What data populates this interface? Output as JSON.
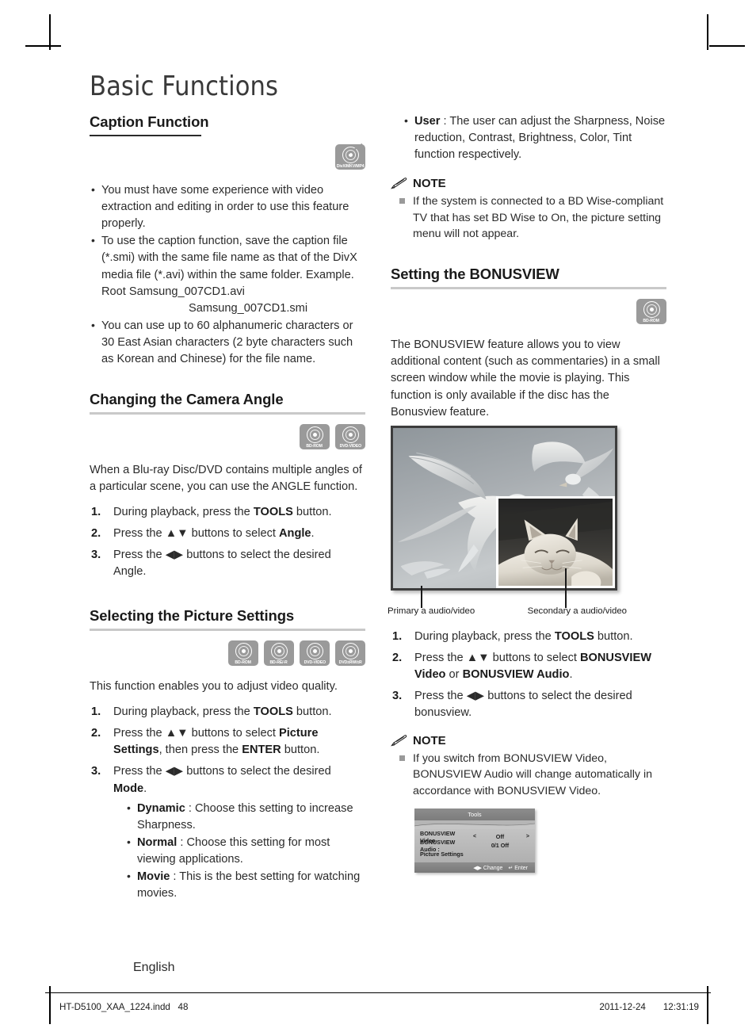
{
  "page": {
    "title": "Basic Functions",
    "language": "English"
  },
  "footer": {
    "file": "HT-D5100_XAA_1224.indd",
    "page_number": "48",
    "date": "2011-12-24",
    "time": "12:31:19"
  },
  "left_column": {
    "caption_section": {
      "heading": "Caption Function",
      "badges": [
        {
          "label": "DivX/MKV/MP4",
          "icon": "disc-icon"
        }
      ],
      "bullets": [
        "You must have some experience with video extraction and editing in order to use this feature properly.",
        "To use the caption function, save the caption file (*.smi) with the same file name as that of the DivX media file (*.avi) within the same folder. Example. Root Samsung_007CD1.avi",
        "You can use up to 60 alphanumeric characters or 30 East Asian characters (2 byte characters such as Korean and Chinese) for the file name."
      ],
      "bullet2_indent_line": "Samsung_007CD1.smi"
    },
    "angle_section": {
      "heading": "Changing the Camera Angle",
      "badges": [
        {
          "label": "BD-ROM",
          "icon": "disc-icon"
        },
        {
          "label": "DVD-VIDEO",
          "icon": "disc-icon"
        }
      ],
      "intro": "When a Blu-ray Disc/DVD contains multiple angles of a particular scene, you can use the ANGLE function.",
      "steps": [
        {
          "num": "1.",
          "pre": "During playback, press the ",
          "bold": "TOOLS",
          "post": " button."
        },
        {
          "num": "2.",
          "pre": "Press the ▲▼ buttons to select ",
          "bold": "Angle",
          "post": "."
        },
        {
          "num": "3.",
          "pre": "Press the ◀▶ buttons to select the desired ",
          "bold": "",
          "post": "Angle."
        }
      ]
    },
    "picture_section": {
      "heading": "Selecting the Picture Settings",
      "badges": [
        {
          "label": "BD-ROM",
          "icon": "disc-icon"
        },
        {
          "label": "BD-RE/-R",
          "icon": "disc-icon"
        },
        {
          "label": "DVD-VIDEO",
          "icon": "disc-icon"
        },
        {
          "label": "DVD±RW/±R",
          "icon": "disc-icon"
        }
      ],
      "intro": "This function enables you to adjust video quality.",
      "steps": [
        {
          "num": "1.",
          "pre": "During playback, press the ",
          "bold": "TOOLS",
          "post": " button."
        },
        {
          "num": "2.",
          "pre": "Press the ▲▼ buttons to select ",
          "bold": "Picture Settings",
          "post": ", then press the ",
          "bold2": "ENTER",
          "post2": " button."
        },
        {
          "num": "3.",
          "pre": "Press the ◀▶ buttons to select the desired ",
          "bold": "Mode",
          "post": "."
        }
      ],
      "modes": [
        {
          "name": "Dynamic",
          "desc": " : Choose this setting to increase Sharpness."
        },
        {
          "name": "Normal",
          "desc": " : Choose this setting for most viewing applications."
        },
        {
          "name": "Movie",
          "desc": " : This is the best setting for watching movies."
        }
      ]
    }
  },
  "right_column": {
    "user_mode": {
      "name": "User",
      "desc": " : The user can adjust the Sharpness, Noise reduction, Contrast, Brightness, Color, Tint function respectively."
    },
    "note1": {
      "label": "NOTE",
      "icon": "pencil-icon",
      "items": [
        "If the system is connected to a BD Wise-compliant TV that has set BD Wise to On, the picture setting menu will not appear."
      ]
    },
    "bonusview_section": {
      "heading": "Setting the BONUSVIEW",
      "badges": [
        {
          "label": "BD-ROM",
          "icon": "disc-icon"
        }
      ],
      "intro": "The BONUSVIEW feature allows you to view additional content (such as commentaries) in a small screen window while the movie is playing. This function is only available if the disc has the Bonusview feature.",
      "figure": {
        "primary_caption": "Primary a audio/video",
        "secondary_caption": "Secondary a audio/video",
        "primary_alt": "seagulls-flying-photo",
        "secondary_alt": "sleeping-cat-photo"
      },
      "steps": [
        {
          "num": "1.",
          "pre": "During playback, press the ",
          "bold": "TOOLS",
          "post": " button."
        },
        {
          "num": "2.",
          "pre": "Press the ▲▼ buttons to select ",
          "bold": "BONUSVIEW Video",
          "mid": " or ",
          "bold2": "BONUSVIEW Audio",
          "post": "."
        },
        {
          "num": "3.",
          "pre": "Press the ◀▶ buttons to select the desired bonusview.",
          "bold": "",
          "post": ""
        }
      ]
    },
    "note2": {
      "label": "NOTE",
      "icon": "pencil-icon",
      "items": [
        "If you switch from BONUSVIEW Video, BONUSVIEW Audio will change automatically in accordance with BONUSVIEW Video."
      ]
    },
    "osd": {
      "title": "Tools",
      "rows": [
        {
          "label": "BONUSVIEW Video",
          "left_arrow": "<",
          "value": "Off",
          "right_arrow": ">"
        },
        {
          "label": "BONUSVIEW Audio :",
          "left_arrow": "",
          "value": "0/1 Off",
          "right_arrow": ""
        },
        {
          "label": "Picture Settings",
          "left_arrow": "",
          "value": "",
          "right_arrow": ""
        }
      ],
      "footer_change": "◀▶ Change",
      "footer_enter": "↵ Enter"
    }
  }
}
